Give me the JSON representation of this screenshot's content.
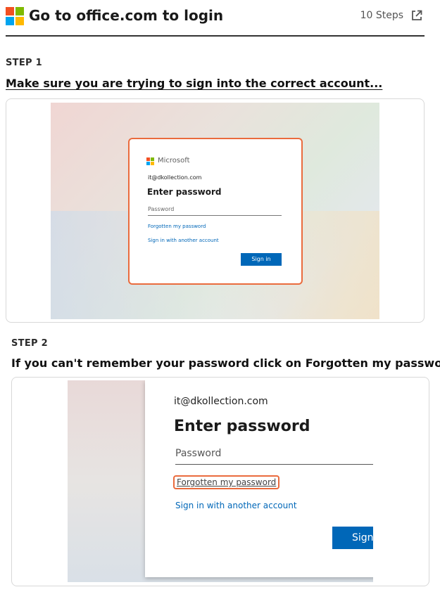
{
  "header": {
    "title": "Go to office.com to login",
    "steps_count": "10 Steps",
    "logo_icon": "microsoft-logo",
    "share_icon": "external-link-icon"
  },
  "steps": [
    {
      "label": "STEP 1",
      "text": "Make sure you are trying to sign into the correct account...",
      "screenshot": {
        "brand": "Microsoft",
        "email": "it@dkollection.com",
        "heading": "Enter password",
        "password_placeholder": "Password",
        "forgot_link": "Forgotten my password",
        "another_account_link": "Sign in with another account",
        "sign_in_button": "Sign in"
      }
    },
    {
      "label": "STEP 2",
      "text": "If you can't remember your password click on Forgotten my password",
      "screenshot": {
        "email": "it@dkollection.com",
        "heading": "Enter password",
        "password_placeholder": "Password",
        "forgot_link": "Forgotten my password",
        "another_account_link": "Sign in with another account",
        "sign_in_button": "Sign"
      }
    }
  ],
  "colors": {
    "highlight": "#ea6b3d",
    "link_blue": "#0067b8",
    "button_blue": "#0067b8"
  }
}
